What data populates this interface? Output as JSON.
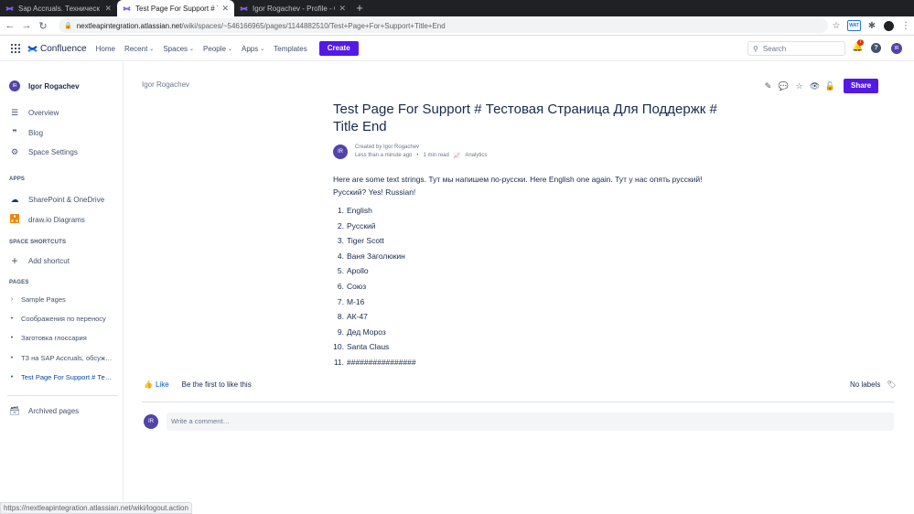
{
  "browser": {
    "tabs": [
      {
        "title": "Sap Accruals. Техническ",
        "active": false
      },
      {
        "title": "Test Page For Support # Т",
        "active": true
      },
      {
        "title": "Igor Rogachev - Profile - C",
        "active": false
      }
    ],
    "new_tab": "+",
    "url_host": "nextleapintegration.atlassian.net",
    "url_path": "/wiki/spaces/~546166965/pages/1144882510/Test+Page+For+Support+Title+End",
    "ext_label": "WAT",
    "status_url": "https://nextleapintegration.atlassian.net/wiki/logout.action"
  },
  "topnav": {
    "product": "Confluence",
    "items": [
      {
        "label": "Home",
        "dropdown": false
      },
      {
        "label": "Recent",
        "dropdown": true
      },
      {
        "label": "Spaces",
        "dropdown": true
      },
      {
        "label": "People",
        "dropdown": true
      },
      {
        "label": "Apps",
        "dropdown": true
      },
      {
        "label": "Templates",
        "dropdown": false
      }
    ],
    "create": "Create",
    "search_placeholder": "Search",
    "notifications": "7",
    "help": "?",
    "user_initials": "IR"
  },
  "sidebar": {
    "space_initials": "IR",
    "space_name": "Igor Rogachev",
    "nav": [
      {
        "icon": "overview-icon",
        "label": "Overview"
      },
      {
        "icon": "blog-icon",
        "label": "Blog"
      },
      {
        "icon": "gear-icon",
        "label": "Space Settings"
      }
    ],
    "apps_heading": "APPS",
    "apps": [
      {
        "icon": "cloud-icon",
        "label": "SharePoint & OneDrive"
      },
      {
        "icon": "drawio-icon",
        "label": "draw.io Diagrams"
      }
    ],
    "shortcuts_heading": "SPACE SHORTCUTS",
    "add_shortcut": "Add shortcut",
    "pages_heading": "PAGES",
    "pages": [
      {
        "label": "Sample Pages",
        "bullet": "›"
      },
      {
        "label": "Соображения по переносу",
        "bullet": "•"
      },
      {
        "label": "Заготовка глоссария",
        "bullet": "•"
      },
      {
        "label": "ТЗ на SAP Accruals, обсуждение",
        "bullet": "•"
      },
      {
        "label": "Test Page For Support # Тестовая",
        "bullet": "•",
        "current": true
      }
    ],
    "archived": "Archived pages"
  },
  "page": {
    "breadcrumb": "Igor Rogachev",
    "share": "Share",
    "title": "Test Page For Support # Тестовая Страница Для Поддержк # Title End",
    "author_initials": "IR",
    "created_by": "Created by Igor Rogachev",
    "time": "Less than a minute ago",
    "read": "1 min read",
    "analytics": "Analytics",
    "paragraph": "Here are some text strings. Тут мы напишем по-русски. Here English one again. Тут у нас опять русский! Русский? Yes! Russian!",
    "list": [
      "English",
      "Русский",
      "Tiger Scott",
      "Ваня Заголюкин",
      "Apollo",
      "Союз",
      "M-16",
      "АК-47",
      "Дед Мороз",
      "Santa Claus",
      "################"
    ],
    "like": "Like",
    "first_like": "Be the first to like this",
    "labels": "No labels",
    "comment_placeholder": "Write a comment…",
    "commenter_initials": "IR"
  }
}
